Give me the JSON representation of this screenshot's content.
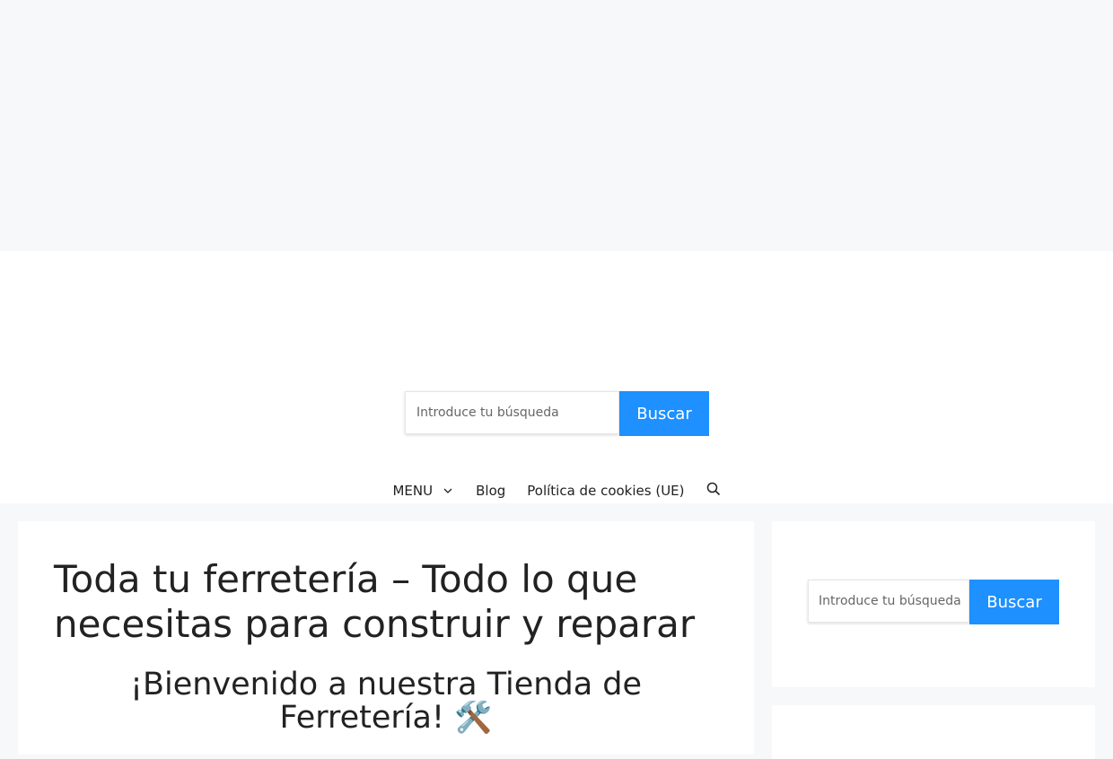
{
  "header": {
    "search": {
      "placeholder": "Introduce tu búsqueda",
      "button_label": "Buscar"
    }
  },
  "nav": {
    "items": [
      {
        "label": "MENU",
        "has_dropdown": true
      },
      {
        "label": "Blog"
      },
      {
        "label": "Política de cookies (UE)"
      }
    ],
    "search_icon": "search-icon"
  },
  "article": {
    "title": "Toda tu ferretería – Todo lo que necesitas para construir y reparar",
    "subtitle": "¡Bienvenido a nuestra Tienda de Ferretería!",
    "subtitle_emoji": "🛠️"
  },
  "sidebar": {
    "search": {
      "placeholder": "Introduce tu búsqueda",
      "button_label": "Buscar"
    }
  },
  "colors": {
    "accent": "#1e90ff",
    "page_background": "#f7f8f9",
    "card_background": "#ffffff",
    "text": "#222222"
  }
}
